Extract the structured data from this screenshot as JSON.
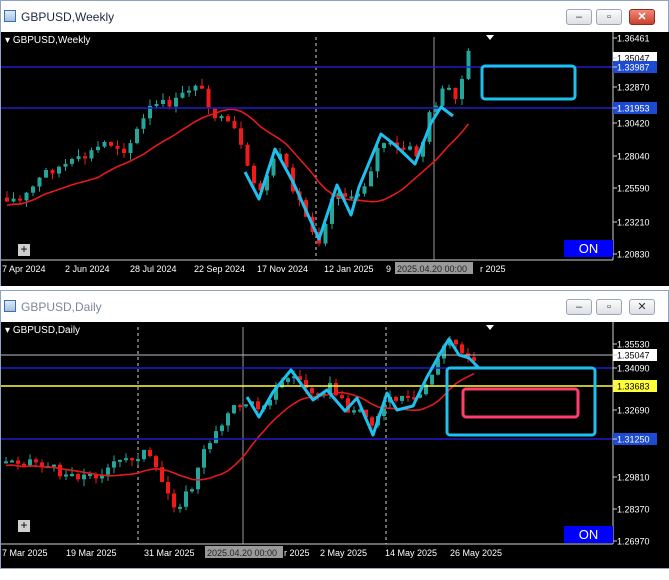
{
  "windows": [
    {
      "title": "GBPUSD,Weekly",
      "chart_label": "GBPUSD,Weekly",
      "y_ticks": [
        "1.36461",
        "1.35047",
        "1.33987",
        "1.32870",
        "1.31953",
        "1.30420",
        "1.28040",
        "1.25590",
        "1.23210",
        "1.20830"
      ],
      "x_ticks": [
        "7 Apr 2024",
        "2 Jun 2024",
        "28 Jul 2024",
        "22 Sep 2024",
        "17 Nov 2024",
        "12 Jan 2025",
        "9",
        "2025.04.20 00:00",
        "r 2025"
      ],
      "on_label": "ON",
      "buttons": {
        "minimize": "–",
        "maximize": "▫",
        "close": "✕"
      }
    },
    {
      "title": "GBPUSD,Daily",
      "chart_label": "GBPUSD,Daily",
      "y_ticks": [
        "1.35530",
        "1.35047",
        "1.34090",
        "1.33683",
        "1.32690",
        "1.31250",
        "1.29810",
        "1.28370",
        "1.26970"
      ],
      "x_ticks": [
        "7 Mar 2025",
        "19 Mar 2025",
        "31 Mar 2025",
        "2025.04.20 00:00",
        "r 2025",
        "2 May 2025",
        "14 May 2025",
        "26 May 2025"
      ],
      "on_label": "ON",
      "buttons": {
        "minimize": "–",
        "maximize": "▫",
        "close": "✕"
      }
    }
  ],
  "colors": {
    "bull": "#26a69a",
    "bear": "#ef1a1a",
    "ma": "#e31a1a",
    "hline_blue": "#1d1dc8",
    "hline_yellow": "#ffff3a",
    "annotation_cyan": "#1ec0ee",
    "box_pink": "#ff3d6e",
    "price_tag_blue": "#1c4ad1",
    "price_tag_yellow": "#ffff3a"
  }
}
